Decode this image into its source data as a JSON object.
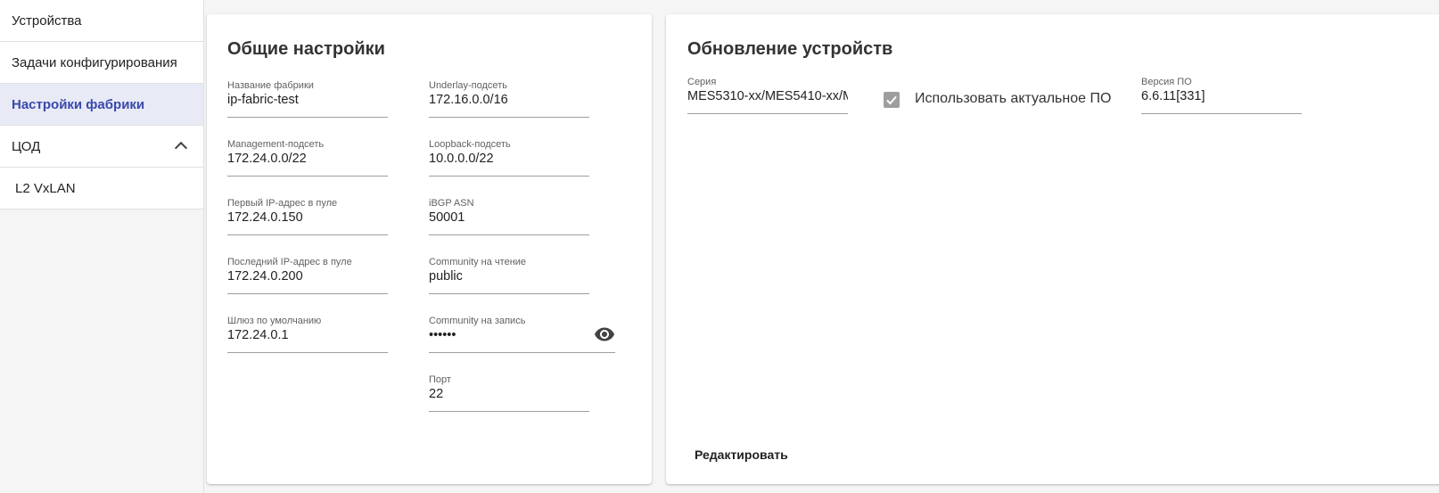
{
  "sidebar": {
    "items": [
      {
        "label": "Устройства"
      },
      {
        "label": "Задачи конфигурирования"
      },
      {
        "label": "Настройки фабрики",
        "active": true
      },
      {
        "label": "ЦОД",
        "expanded": true
      },
      {
        "label": "L2 VxLAN"
      }
    ]
  },
  "general": {
    "title": "Общие настройки",
    "fabric_name": {
      "label": "Название фабрики",
      "value": "ip-fabric-test"
    },
    "underlay_subnet": {
      "label": "Underlay-подсеть",
      "value": "172.16.0.0/16"
    },
    "mgmt_subnet": {
      "label": "Management-подсеть",
      "value": "172.24.0.0/22"
    },
    "loopback_subnet": {
      "label": "Loopback-подсеть",
      "value": "10.0.0.0/22"
    },
    "first_ip": {
      "label": "Первый IP-адрес в пуле",
      "value": "172.24.0.150"
    },
    "ibgp_asn": {
      "label": "iBGP ASN",
      "value": "50001"
    },
    "last_ip": {
      "label": "Последний IP-адрес в пуле",
      "value": "172.24.0.200"
    },
    "community_read": {
      "label": "Community на чтение",
      "value": "public"
    },
    "gateway": {
      "label": "Шлюз по умолчанию",
      "value": "172.24.0.1"
    },
    "community_write": {
      "label": "Community на запись",
      "value": "••••••"
    },
    "port": {
      "label": "Порт",
      "value": "22"
    }
  },
  "update": {
    "title": "Обновление устройств",
    "series": {
      "label": "Серия",
      "value": "MES5310-xx/MES5410-xx/M"
    },
    "use_latest_label": "Использовать актуальное ПО",
    "use_latest_checked": true,
    "version": {
      "label": "Версия ПО",
      "value": "6.6.11[331]"
    },
    "edit_label": "Редактировать"
  },
  "colors": {
    "accent": "#3949ab",
    "active_bg": "#e8eaf6",
    "checkbox": "#9e9e9e"
  }
}
